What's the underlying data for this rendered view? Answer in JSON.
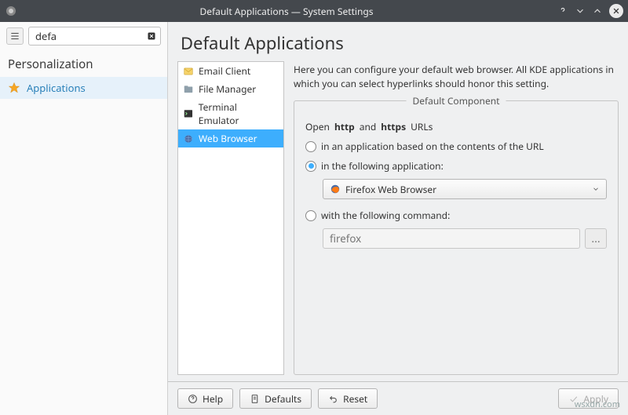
{
  "window": {
    "title": "Default Applications — System Settings"
  },
  "sidebar": {
    "search_value": "defa",
    "section": "Personalization",
    "items": [
      {
        "label": "Applications"
      }
    ]
  },
  "page": {
    "title": "Default Applications",
    "categories": [
      {
        "label": "Email Client",
        "icon": "mail-icon"
      },
      {
        "label": "File Manager",
        "icon": "folder-icon"
      },
      {
        "label": "Terminal Emulator",
        "icon": "terminal-icon"
      },
      {
        "label": "Web Browser",
        "icon": "globe-icon"
      }
    ],
    "description": "Here you can configure your default web browser. All KDE applications in which you can select hyperlinks should honor this setting.",
    "groupbox_title": "Default Component",
    "open_line_prefix": "Open ",
    "open_line_http": "http",
    "open_line_and": " and ",
    "open_line_https": "https",
    "open_line_suffix": " URLs",
    "radio1": "in an application based on the contents of the URL",
    "radio2": "in the following application:",
    "radio3": "with the following command:",
    "combo_value": "Firefox Web Browser",
    "cmd_placeholder": "firefox"
  },
  "buttons": {
    "help": "Help",
    "defaults": "Defaults",
    "reset": "Reset",
    "apply": "Apply"
  },
  "watermark": "wsxdn.com"
}
